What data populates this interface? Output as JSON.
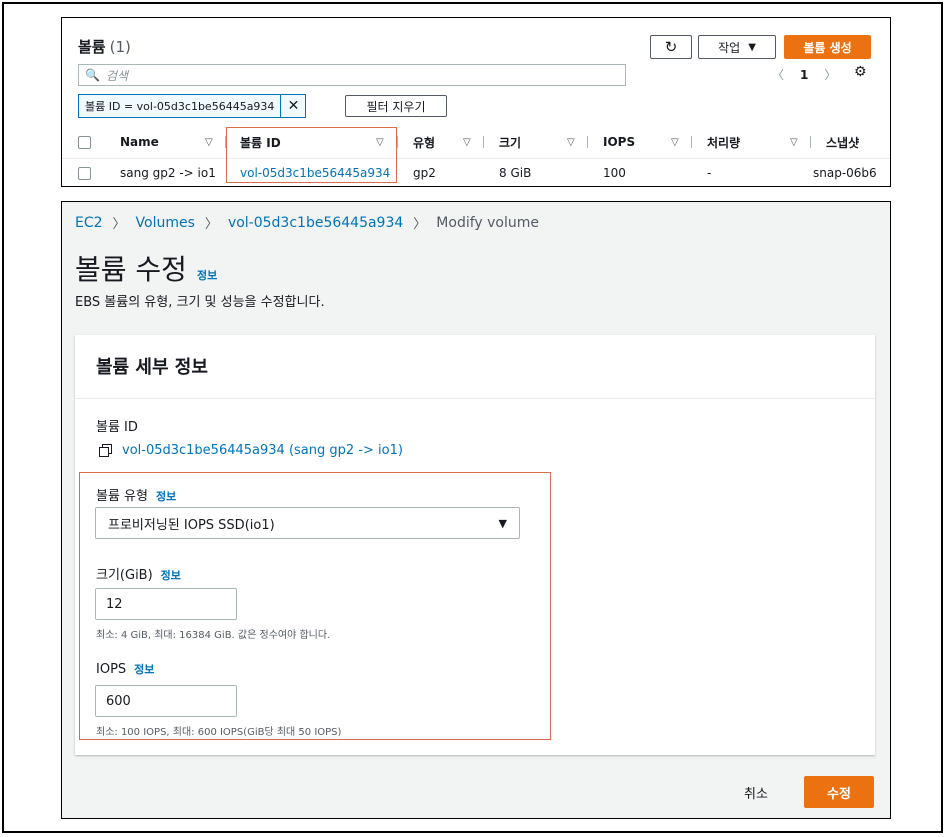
{
  "top": {
    "title": "볼륨",
    "count": "(1)",
    "refresh_icon": "refresh-icon",
    "action_label": "작업",
    "create_label": "볼륨 생성",
    "search_placeholder": "검색",
    "page_number": "1",
    "filter_chip": "볼륨 ID = vol-05d3c1be56445a934",
    "clear_filter_label": "필터 지우기",
    "columns": [
      "Name",
      "볼륨 ID",
      "유형",
      "크기",
      "IOPS",
      "처리량",
      "스냅샷"
    ],
    "row": {
      "name": "sang gp2 -> io1",
      "volume_id": "vol-05d3c1be56445a934",
      "type": "gp2",
      "size": "8 GiB",
      "iops": "100",
      "throughput": "-",
      "snapshot": "snap-06b6"
    }
  },
  "breadcrumb": {
    "ec2": "EC2",
    "volumes": "Volumes",
    "volume_id": "vol-05d3c1be56445a934",
    "current": "Modify volume"
  },
  "page": {
    "title": "볼륨 수정",
    "info": "정보",
    "subtitle": "EBS 볼륨의 유형, 크기 및 성능을 수정합니다."
  },
  "card": {
    "title": "볼륨 세부 정보",
    "volume_id_label": "볼륨 ID",
    "volume_id_value": "vol-05d3c1be56445a934 (sang gp2 -> io1)",
    "type_label": "볼륨 유형",
    "type_info": "정보",
    "type_value": "프로비저닝된 IOPS SSD(io1)",
    "size_label": "크기(GiB)",
    "size_info": "정보",
    "size_value": "12",
    "size_hint": "최소: 4 GiB, 최대: 16384 GiB. 값은 정수여야 합니다.",
    "iops_label": "IOPS",
    "iops_info": "정보",
    "iops_value": "600",
    "iops_hint": "최소: 100 IOPS, 최대: 600 IOPS(GiB당 최대 50 IOPS)"
  },
  "footer": {
    "cancel_label": "취소",
    "submit_label": "수정"
  },
  "colors": {
    "accent": "#ec7211",
    "link": "#0073bb",
    "highlight": "#d86c4b"
  }
}
